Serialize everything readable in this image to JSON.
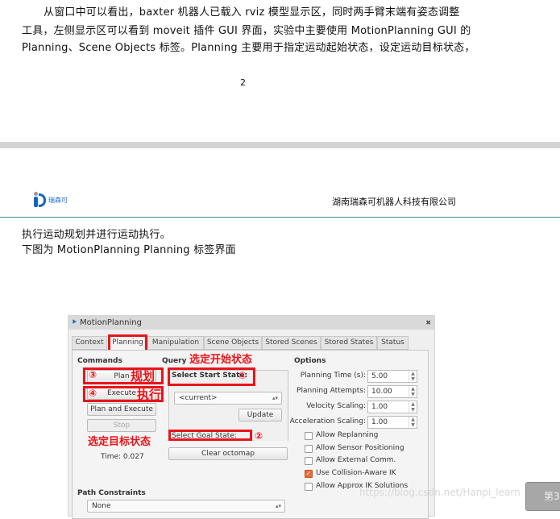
{
  "doc": {
    "para_lines": [
      "从窗口中可以看出，baxter 机器人已载入 rviz 模型显示区，同时两手臂末端有姿态调整",
      "工具，左侧显示区可以看到 moveit 插件 GUI 界面，实验中主要使用 MotionPlanning GUI 的",
      "Planning、Scene Objects 标签。Planning 主要用于指定运动起始状态，设定运动目标状态，"
    ],
    "page_number": "2",
    "logo_text": "瑞森可",
    "company": "湖南瑞森可机器人科技有限公司",
    "line4": "执行运动规划并进行运动执行。",
    "line5": "下图为 MotionPlanning Planning 标签界面",
    "watermark": "https://blog.csdn.net/Hanpi_learn",
    "page_badge": "第3"
  },
  "window": {
    "title": "MotionPlanning",
    "tabs": [
      "Context",
      "Planning",
      "Manipulation",
      "Scene Objects",
      "Stored Scenes",
      "Stored States",
      "Status"
    ],
    "active_tab": "Planning",
    "commands": {
      "heading": "Commands",
      "plan": "Plan",
      "execute": "Execute",
      "plan_and_execute": "Plan and Execute",
      "stop": "Stop",
      "time": "Time: 0.027"
    },
    "query": {
      "heading": "Query",
      "start_state": "Select Start State:",
      "start_value": "<current>",
      "update": "Update",
      "goal_state": "Select Goal State:",
      "clear_octomap": "Clear octomap"
    },
    "options": {
      "heading": "Options",
      "fields": [
        {
          "label": "Planning Time (s):",
          "value": "5.00"
        },
        {
          "label": "Planning Attempts:",
          "value": "10.00"
        },
        {
          "label": "Velocity Scaling:",
          "value": "1.00"
        },
        {
          "label": "Acceleration Scaling:",
          "value": "1.00"
        }
      ],
      "checks": [
        {
          "label": "Allow Replanning",
          "checked": false
        },
        {
          "label": "Allow Sensor Positioning",
          "checked": false
        },
        {
          "label": "Allow External Comm.",
          "checked": false
        },
        {
          "label": "Use Collision-Aware IK",
          "checked": true
        },
        {
          "label": "Allow Approx IK Solutions",
          "checked": false
        }
      ]
    },
    "path_constraints": {
      "heading": "Path Constraints",
      "value": "None"
    }
  },
  "annotations": {
    "select_start": "选定开始状态",
    "select_goal": "选定目标状态",
    "plan": "规划",
    "execute": "执行",
    "n1": "①",
    "n2": "②",
    "n3": "③",
    "n4": "④"
  },
  "colors": {
    "annotation_red": "#e8141a",
    "teal_rule": "#3f8c96",
    "check_orange": "#e8693a"
  }
}
